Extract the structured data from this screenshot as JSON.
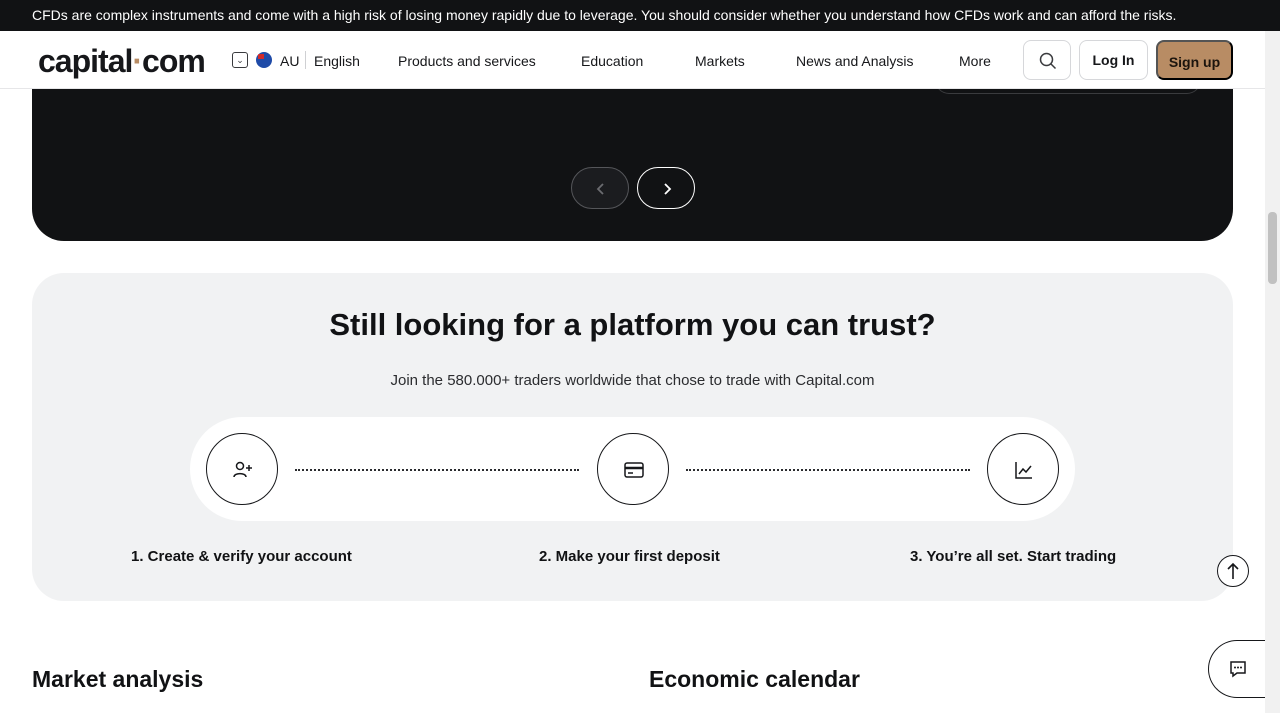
{
  "risk_warning": "CFDs are complex instruments and come with a high risk of losing money rapidly due to leverage. You should consider whether you understand how CFDs work and can afford the risks.",
  "header": {
    "logo_main": "capital",
    "logo_dot": "·",
    "logo_tld": "com",
    "country": "AU",
    "language": "English",
    "nav": {
      "products": "Products and services",
      "education": "Education",
      "markets": "Markets",
      "news": "News and Analysis",
      "more": "More"
    },
    "login": "Log In",
    "signup": "Sign up"
  },
  "trust": {
    "title": "Still looking for a platform you can trust?",
    "subtitle": "Join the 580.000+ traders worldwide that chose to trade with Capital.com",
    "steps": [
      {
        "label": "1. Create & verify your account",
        "icon": "add-user-icon"
      },
      {
        "label": "2. Make your first deposit",
        "icon": "credit-card-icon"
      },
      {
        "label": "3. You’re all set. Start trading",
        "icon": "line-chart-icon"
      }
    ]
  },
  "sections": {
    "market_analysis": "Market analysis",
    "economic_calendar": "Economic calendar"
  },
  "colors": {
    "accent": "#b88c64",
    "dark": "#111214",
    "light_panel": "#f1f2f3"
  }
}
